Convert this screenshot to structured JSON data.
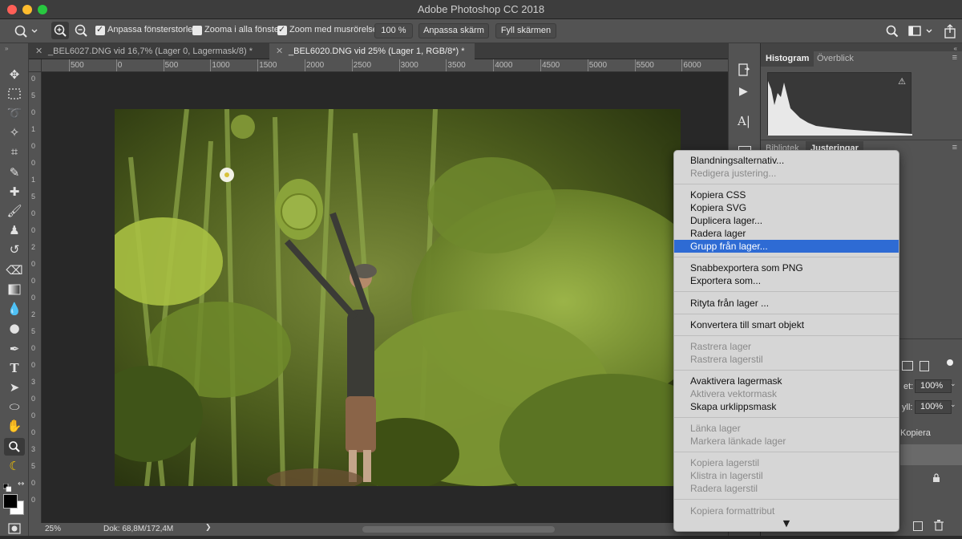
{
  "window": {
    "title": "Adobe Photoshop CC 2018"
  },
  "colors": {
    "highlight": "#2e6bd4",
    "menu_bg": "#d6d6d6",
    "panel_bg": "#535353",
    "canvas_bg": "#282828"
  },
  "options_bar": {
    "tool_icon": "zoom-icon",
    "resize_windows": {
      "label": "Anpassa fönsterstorlek",
      "checked": true
    },
    "zoom_all_windows": {
      "label": "Zooma i alla fönster",
      "checked": false
    },
    "scrubby_zoom": {
      "label": "Zoom med musrörelse",
      "checked": true
    },
    "zoom_value": "100 %",
    "fit_screen": "Anpassa skärm",
    "fill_screen": "Fyll skärmen"
  },
  "tabs": [
    {
      "label": "_BEL6027.DNG vid 16,7% (Lager 0, Lagermask/8) *",
      "active": false
    },
    {
      "label": "_BEL6020.DNG vid 25% (Lager 1, RGB/8*) *",
      "active": true
    }
  ],
  "ruler": {
    "top": [
      "500",
      "0",
      "500",
      "1000",
      "1500",
      "2000",
      "2500",
      "3000",
      "3500",
      "4000",
      "4500",
      "5000",
      "5500",
      "6000"
    ],
    "left": [
      "0",
      "5",
      "0",
      "1",
      "0",
      "0",
      "1",
      "5",
      "0",
      "0",
      "2",
      "0",
      "0",
      "0",
      "2",
      "5",
      "0",
      "0",
      "3",
      "0",
      "0",
      "0",
      "3",
      "5",
      "0",
      "0"
    ]
  },
  "status": {
    "zoom": "25%",
    "doc": "Dok: 68,8M/172,4M",
    "arrow": "❯"
  },
  "panels": {
    "top_tabs": [
      "Histogram",
      "Överblick"
    ],
    "mid_tabs": [
      "Bibliotek",
      "Justeringar"
    ],
    "opacity_label": "et:",
    "opacity_value": "100%",
    "fill_label": "yll:",
    "fill_value": "100%",
    "layer_partial": "Kopiera"
  },
  "context_menu": {
    "items": [
      {
        "label": "Blandningsalternativ...",
        "disabled": false
      },
      {
        "label": "Redigera justering...",
        "disabled": true
      },
      {
        "label": "Kopiera CSS",
        "disabled": false
      },
      {
        "label": "Kopiera SVG",
        "disabled": false
      },
      {
        "label": "Duplicera lager...",
        "disabled": false
      },
      {
        "label": "Radera lager",
        "disabled": false
      },
      {
        "label": "Grupp från lager...",
        "disabled": false,
        "highlighted": true
      },
      {
        "label": "Snabbexportera som PNG",
        "disabled": false
      },
      {
        "label": "Exportera som...",
        "disabled": false
      },
      {
        "label": "Rityta från lager ...",
        "disabled": false
      },
      {
        "label": "Konvertera till smart objekt",
        "disabled": false
      },
      {
        "label": "Rastrera lager",
        "disabled": true
      },
      {
        "label": "Rastrera lagerstil",
        "disabled": true
      },
      {
        "label": "Avaktivera lagermask",
        "disabled": false
      },
      {
        "label": "Aktivera vektormask",
        "disabled": true
      },
      {
        "label": "Skapa urklippsmask",
        "disabled": false
      },
      {
        "label": "Länka lager",
        "disabled": true
      },
      {
        "label": "Markera länkade lager",
        "disabled": true
      },
      {
        "label": "Kopiera lagerstil",
        "disabled": true
      },
      {
        "label": "Klistra in lagerstil",
        "disabled": true
      },
      {
        "label": "Radera lagerstil",
        "disabled": true
      },
      {
        "label": "Kopiera formattribut",
        "disabled": true
      }
    ],
    "more_arrow": "▼"
  }
}
